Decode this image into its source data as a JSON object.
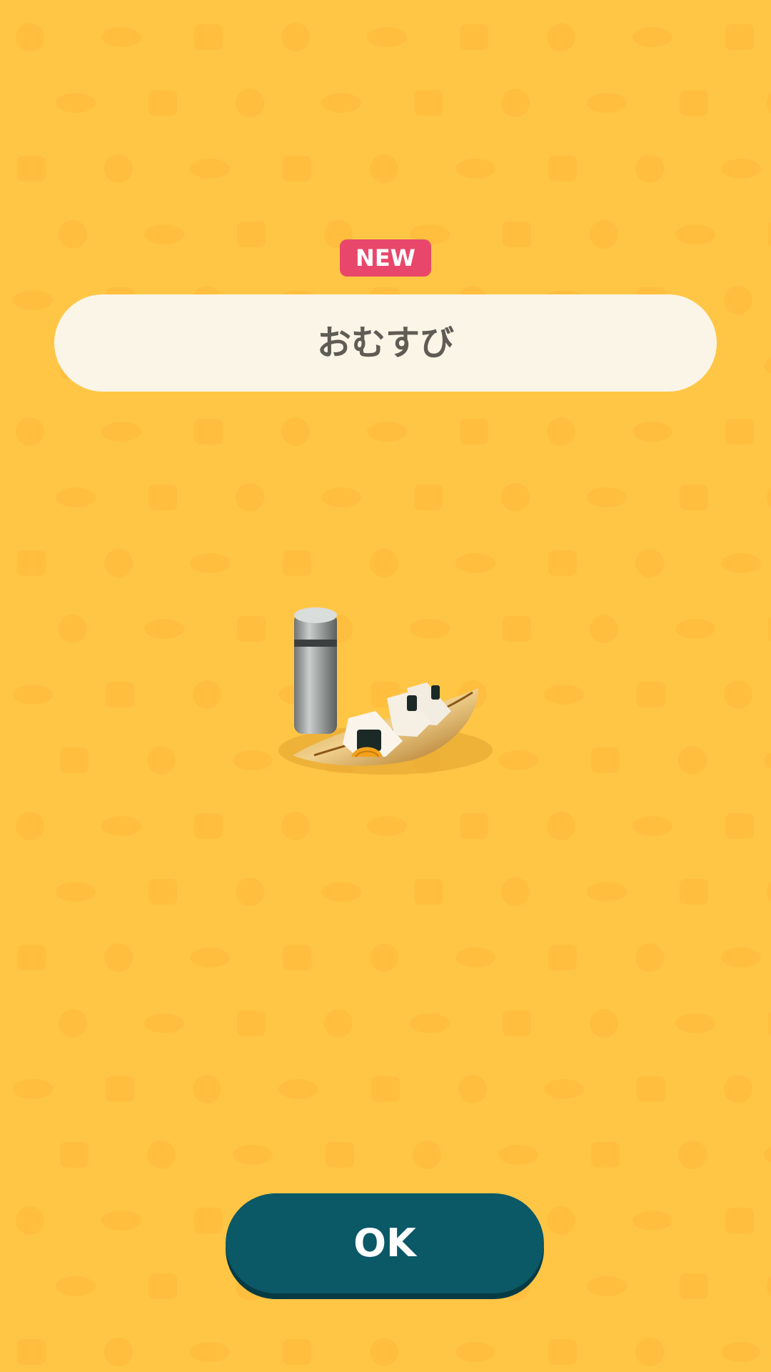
{
  "colors": {
    "background": "#ffc646",
    "pattern": "#ffbe3e",
    "badge": "#e8476b",
    "banner": "#faf5e6",
    "title_text": "#5f5b55",
    "ok_button": "#0b5866"
  },
  "badge": {
    "label": "NEW"
  },
  "item": {
    "name": "おむすび",
    "illustration": "rice-balls-on-bamboo-leaf-with-thermos-icon"
  },
  "actions": {
    "ok_label": "OK"
  }
}
